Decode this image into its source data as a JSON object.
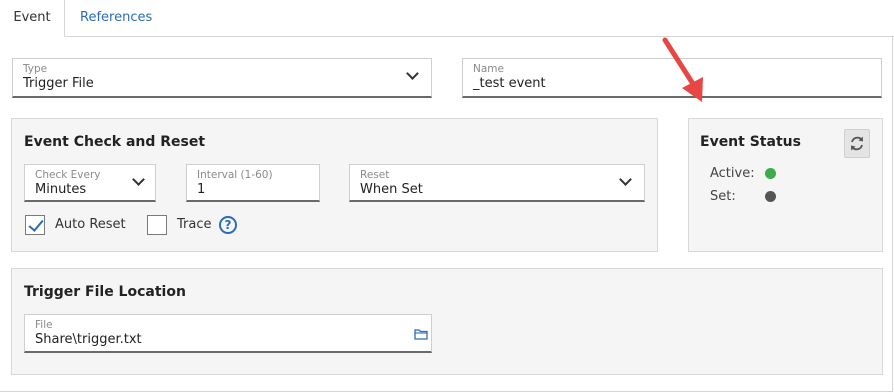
{
  "tabs": [
    {
      "label": "Event",
      "active": true
    },
    {
      "label": "References",
      "active": false
    }
  ],
  "fields": {
    "type": {
      "label": "Type",
      "value": "Trigger File"
    },
    "name": {
      "label": "Name",
      "value": "_test event"
    }
  },
  "check_reset": {
    "title": "Event Check and Reset",
    "check_every": {
      "label": "Check Every",
      "value": "Minutes"
    },
    "interval": {
      "label": "Interval (1-60)",
      "value": "1"
    },
    "reset": {
      "label": "Reset",
      "value": "When Set"
    },
    "auto_reset": {
      "label": "Auto Reset",
      "checked": true
    },
    "trace": {
      "label": "Trace",
      "checked": false
    },
    "help_icon": "?"
  },
  "status": {
    "title": "Event Status",
    "active_label": "Active:",
    "set_label": "Set:",
    "active_color": "#3cab4a",
    "set_color": "#555555"
  },
  "location": {
    "title": "Trigger File Location",
    "file": {
      "label": "File",
      "value": "Share\\trigger.txt"
    }
  },
  "colors": {
    "accent": "#2a6db5",
    "annotation_arrow": "#e84545"
  }
}
